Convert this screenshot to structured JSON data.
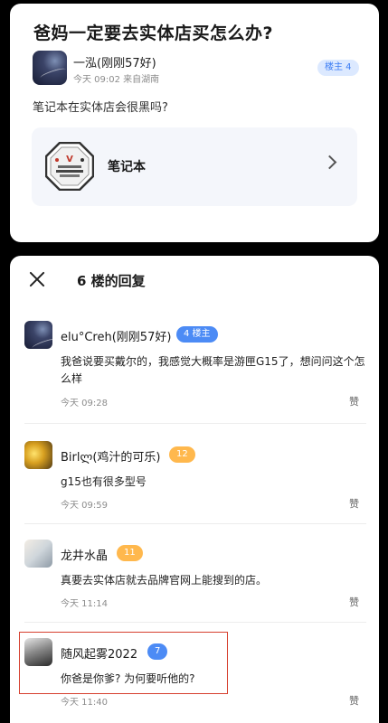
{
  "post": {
    "title": "爸妈一定要去实体店买怎么办?",
    "author": "一泓(刚刚57好)",
    "meta": "今天 09:02 来自湖南",
    "badge": "楼主 4",
    "body": "笔记本在实体店会很黑吗?",
    "topic": {
      "name": "笔记本"
    }
  },
  "panel": {
    "title": "6 楼的回复",
    "replies": [
      {
        "user": "elu°Creh(刚刚57好)",
        "badge": "4 楼主",
        "text": "我爸说要买戴尔的，我感觉大概率是游匣G15了，想问问这个怎么样",
        "time": "今天 09:28",
        "like": "赞"
      },
      {
        "user": "Birlლ(鸡汁的可乐)",
        "badge": "12",
        "text": "g15也有很多型号",
        "time": "今天 09:59",
        "like": "赞"
      },
      {
        "user": "龙井水晶",
        "badge": "11",
        "text": "真要去实体店就去品牌官网上能搜到的店。",
        "time": "今天 11:14",
        "like": "赞"
      },
      {
        "user": "随风起雾2022",
        "badge": "7",
        "text": "你爸是你爹? 为何要听他的?",
        "time": "今天 11:40",
        "like": "赞"
      }
    ]
  },
  "colors": {
    "accent": "#4c8bf5",
    "badge_orange": "#ffb84d",
    "highlight": "#d6402f"
  },
  "icons": {
    "close": "close-icon",
    "chevron": "chevron-right-icon",
    "topic_logo": "laptop-topic-logo"
  }
}
